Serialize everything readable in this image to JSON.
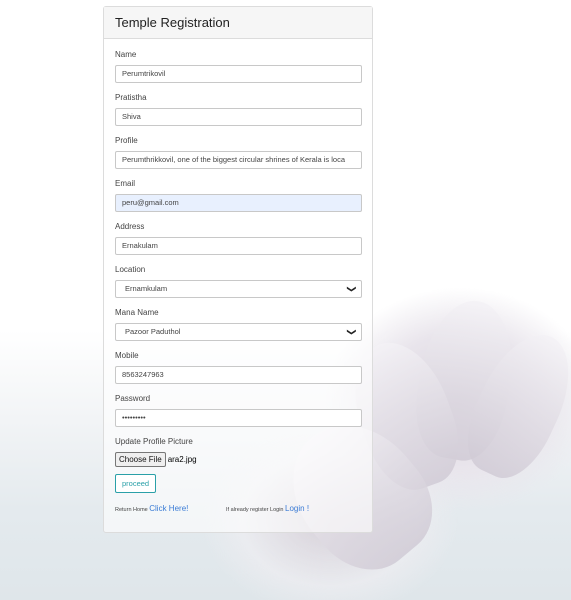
{
  "form": {
    "title": "Temple Registration",
    "fields": [
      {
        "label": "Name",
        "value": "Perumtrikovil"
      },
      {
        "label": "Pratistha",
        "value": "Shiva"
      },
      {
        "label": "Profile",
        "value": "Perumthrikkovil, one of the biggest circular shrines of Kerala is loca"
      },
      {
        "label": "Email",
        "value": "peru@gmail.com"
      },
      {
        "label": "Address",
        "value": "Ernakulam"
      },
      {
        "label": "Location",
        "value": "Ernamkulam"
      },
      {
        "label": "Mana Name",
        "value": "Pazoor Paduthol"
      },
      {
        "label": "Mobile",
        "value": "8563247963"
      },
      {
        "label": "Password",
        "value": "•••••••••"
      }
    ],
    "picture_label": "Update Profile Picture",
    "choose_file": "Choose File",
    "file_name": "ara2.jpg",
    "proceed": "proceed",
    "return_home": "Return Home",
    "click_here": "Click Here!",
    "already_register": "If already register Login",
    "login": "Login !"
  }
}
